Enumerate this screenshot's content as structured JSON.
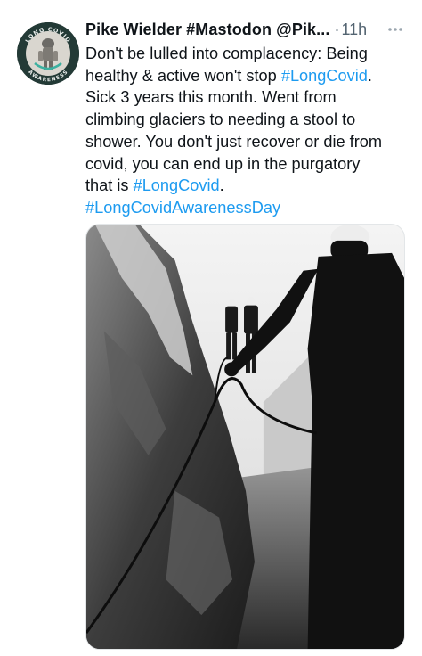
{
  "tweet": {
    "author_name": "Pike Wielder #Mastodon @Pik...",
    "separator": "·",
    "timestamp": "11h",
    "more_icon": "more-dots-icon",
    "avatar": {
      "top_text": "LONG COVID",
      "bottom_text": "AWARENESS",
      "icon": "long-covid-awareness-logo"
    },
    "body_lines": [
      [
        "Don't be lulled into complacency: Being"
      ],
      [
        "healthy & active won't stop ",
        {
          "tag": "#LongCovid"
        },
        "."
      ],
      [
        "Sick 3 years this month. Went from"
      ],
      [
        "climbing glaciers to needing a stool to"
      ],
      [
        "shower. You don't just recover or die from"
      ],
      [
        "covid, you can end up in the purgatory"
      ],
      [
        "that is ",
        {
          "tag": "#LongCovid"
        },
        "."
      ],
      [
        {
          "tag": "#LongCovidAwarenessDay"
        }
      ]
    ],
    "media": {
      "description_icon": "glacier-climbing-photo"
    },
    "colors": {
      "hashtag": "#1d9bf0",
      "text": "#0f1419",
      "secondary": "#536471"
    }
  }
}
